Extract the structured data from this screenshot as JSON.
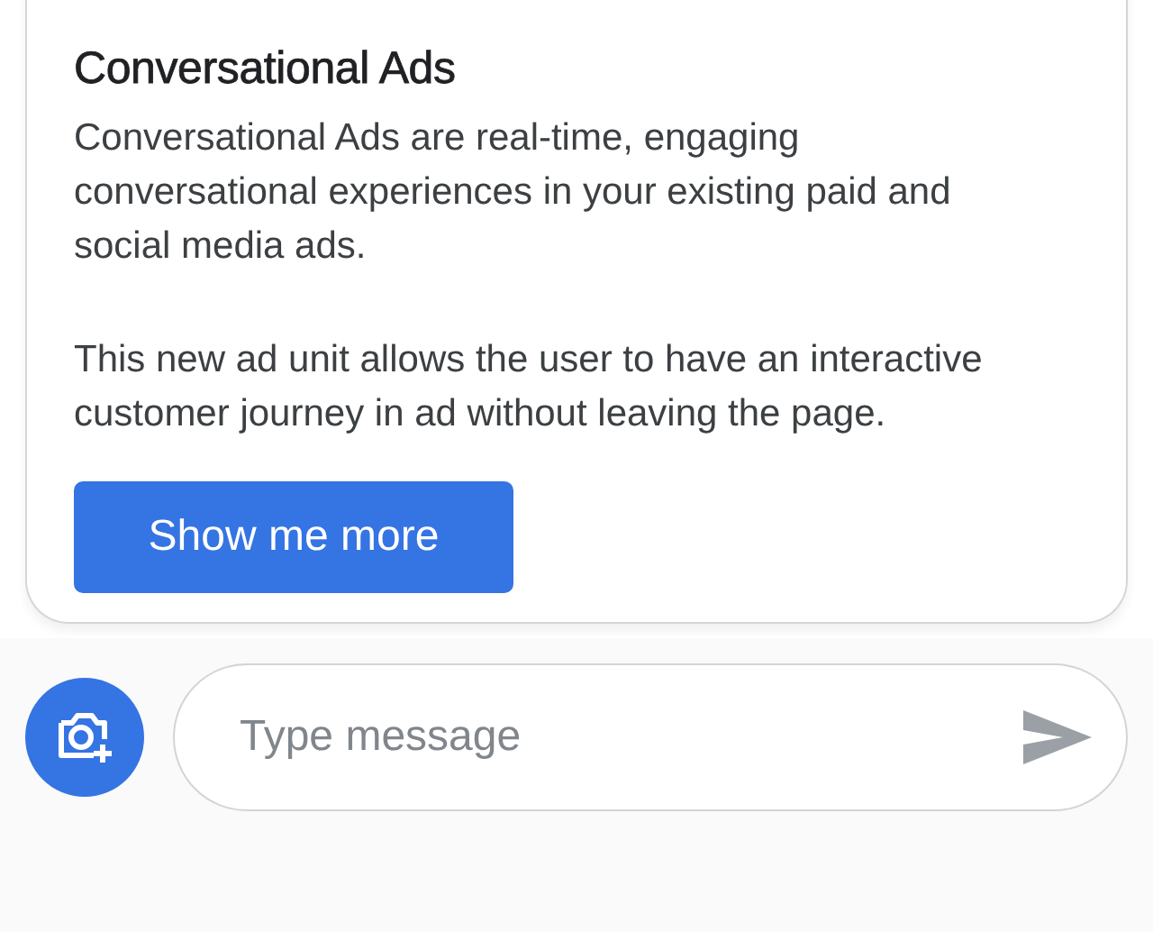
{
  "card": {
    "title": "Conversational Ads",
    "paragraphs": [
      "Conversational Ads are real-time, engaging conversational experiences in your existing paid and social media ads.",
      "This new ad unit allows the user to have an interactive customer journey in ad without leaving the page."
    ],
    "button": "Show me more"
  },
  "composer": {
    "placeholder": "Type message"
  }
}
